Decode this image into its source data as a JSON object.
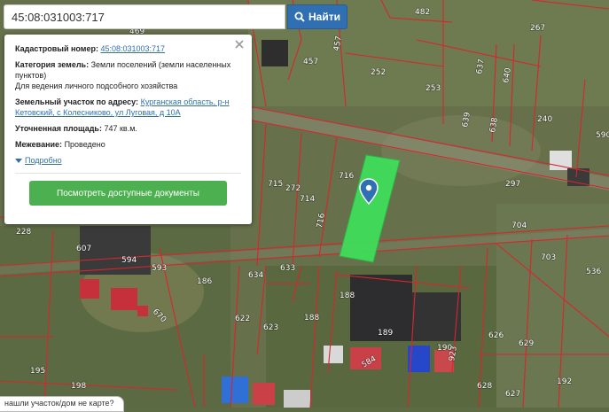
{
  "search": {
    "value": "45:08:031003:717",
    "button_label": "Найти"
  },
  "popup": {
    "cadastral_label": "Кадастровый номер:",
    "cadastral_value": "45:08:031003:717",
    "category_label": "Категория земель:",
    "category_value": "Земли поселений (земли населенных пунктов)",
    "usage_value": "Для ведения личного подсобного хозяйства",
    "address_label": "Земельный участок по адресу:",
    "address_value": "Курганская область, р-н Кетовский, с Колесниково, ул Луговая, д 10А",
    "area_label": "Уточненная площадь:",
    "area_value": "747 кв.м.",
    "survey_label": "Межевание:",
    "survey_value": "Проведено",
    "more_label": "Подробно",
    "docs_button_label": "Посмотреть доступные документы"
  },
  "bottom_hint": "нашли участок/дом не карте?",
  "map": {
    "parcel_labels": [
      "482",
      "267",
      "469",
      "457",
      "457",
      "252",
      "253",
      "637",
      "640",
      "639",
      "638",
      "240",
      "590",
      "715",
      "272",
      "716",
      "714",
      "716",
      "297",
      "228",
      "607",
      "594",
      "593",
      "186",
      "634",
      "633",
      "704",
      "703",
      "536",
      "188",
      "622",
      "623",
      "188",
      "189",
      "190",
      "626",
      "629",
      "584",
      "923",
      "195",
      "198",
      "628",
      "627",
      "192",
      "670"
    ],
    "selected_parcel_color": "#3ee05a",
    "marker_color": "#2f6fb2"
  }
}
